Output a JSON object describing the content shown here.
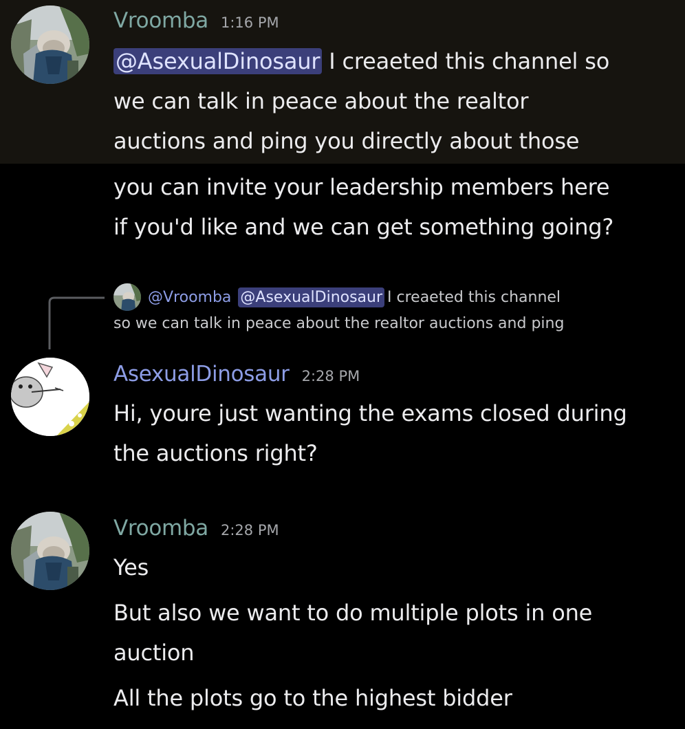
{
  "colors": {
    "background": "#000000",
    "highlight_background": "#16140f",
    "vroomba_name": "#7fa8a3",
    "asexualdinosaur_name": "#8d9de6",
    "mention_bg": "#3b3f7a",
    "timestamp": "#a5a7ab"
  },
  "messages": [
    {
      "author": "Vroomba",
      "time": "1:16 PM",
      "mention": "@AsexualDinosaur",
      "lines": [
        " I creaeted this channel so",
        "we can talk in peace about the realtor",
        "auctions and ping you directly about those"
      ]
    },
    {
      "author": "Vroomba",
      "lines": [
        "you can invite your leadership members here",
        "if you'd like and we can get something going?"
      ]
    },
    {
      "author": "AsexualDinosaur",
      "time": "2:28 PM",
      "reply": {
        "author": "@Vroomba",
        "mention": "@AsexualDinosaur",
        "line1_rest": "I creaeted this channel",
        "line2": "so we can talk in peace about the realtor auctions and ping"
      },
      "lines": [
        "Hi, youre just wanting the exams closed during",
        "the auctions right?"
      ]
    },
    {
      "author": "Vroomba",
      "time": "2:28 PM",
      "lines": [
        "Yes",
        "But also we want to do multiple plots in one",
        "auction",
        "All the plots go to the highest bidder"
      ]
    }
  ],
  "icons": {
    "vroomba_avatar": "shark-hoodie-avatar-icon",
    "dinosaur_avatar": "mouse-cheese-avatar-icon"
  }
}
